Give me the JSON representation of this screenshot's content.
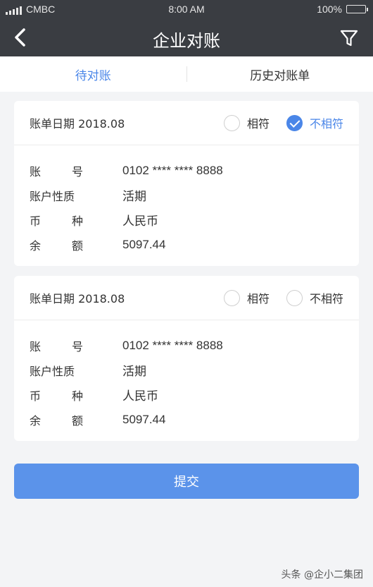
{
  "status_bar": {
    "carrier": "CMBC",
    "time": "8:00 AM",
    "battery": "100%"
  },
  "nav": {
    "title": "企业对账",
    "back_icon": "chevron-left-icon",
    "filter_icon": "filter-icon"
  },
  "tabs": [
    {
      "label": "待对账",
      "active": true
    },
    {
      "label": "历史对账单",
      "active": false
    }
  ],
  "labels": {
    "account_a": "账",
    "account_b": "号",
    "nature": "账户性质",
    "currency_a": "币",
    "currency_b": "种",
    "balance_a": "余",
    "balance_b": "额"
  },
  "statements": [
    {
      "date": "账单日期 2018.08",
      "option_match": "相符",
      "option_mismatch": "不相符",
      "selected": "不相符",
      "account": "0102 **** **** 8888",
      "nature": "活期",
      "currency": "人民币",
      "balance": "5097.44"
    },
    {
      "date": "账单日期 2018.08",
      "option_match": "相符",
      "option_mismatch": "不相符",
      "selected": "",
      "account": "0102 **** **** 8888",
      "nature": "活期",
      "currency": "人民币",
      "balance": "5097.44"
    }
  ],
  "submit_label": "提交",
  "watermark": "头条 @企小二集团",
  "colors": {
    "accent": "#4a86e8",
    "header": "#3a3d42",
    "button": "#5b93ea"
  }
}
